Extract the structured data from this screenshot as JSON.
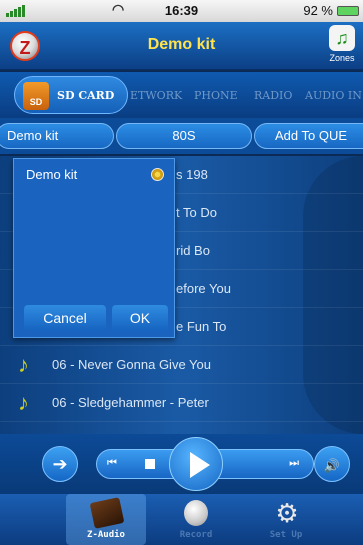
{
  "status_bar": {
    "time": "16:39",
    "battery_text": "92 %"
  },
  "header": {
    "title": "Demo kit",
    "zones_label": "Zones"
  },
  "source_tabs": [
    {
      "label": "SD CARD",
      "sd_text": "SD"
    },
    {
      "label": "ETWORK"
    },
    {
      "label": "PHONE"
    },
    {
      "label": "RADIO"
    },
    {
      "label": "AUDIO IN"
    }
  ],
  "selection_bar": {
    "playlist": "Demo kit",
    "genre": "80S",
    "action": "Add To QUE"
  },
  "tracks": [
    {
      "text": "s 198"
    },
    {
      "text": "t To Do"
    },
    {
      "text": "rid Bo"
    },
    {
      "text": "efore You"
    },
    {
      "text": "e Fun To"
    },
    {
      "text": "06 - Never Gonna Give You"
    },
    {
      "text": "06 - Sledgehammer - Peter"
    }
  ],
  "dialog": {
    "option": "Demo kit",
    "cancel": "Cancel",
    "ok": "OK"
  },
  "bottom_tabs": [
    {
      "label": "Z-Audio"
    },
    {
      "label": "Record"
    },
    {
      "label": "Set Up"
    }
  ],
  "colors": {
    "title_yellow": "#ffe34d",
    "active_tab": "#2f8ae0",
    "record_label": "#4c78b0",
    "setup_label": "#4c78b0"
  }
}
